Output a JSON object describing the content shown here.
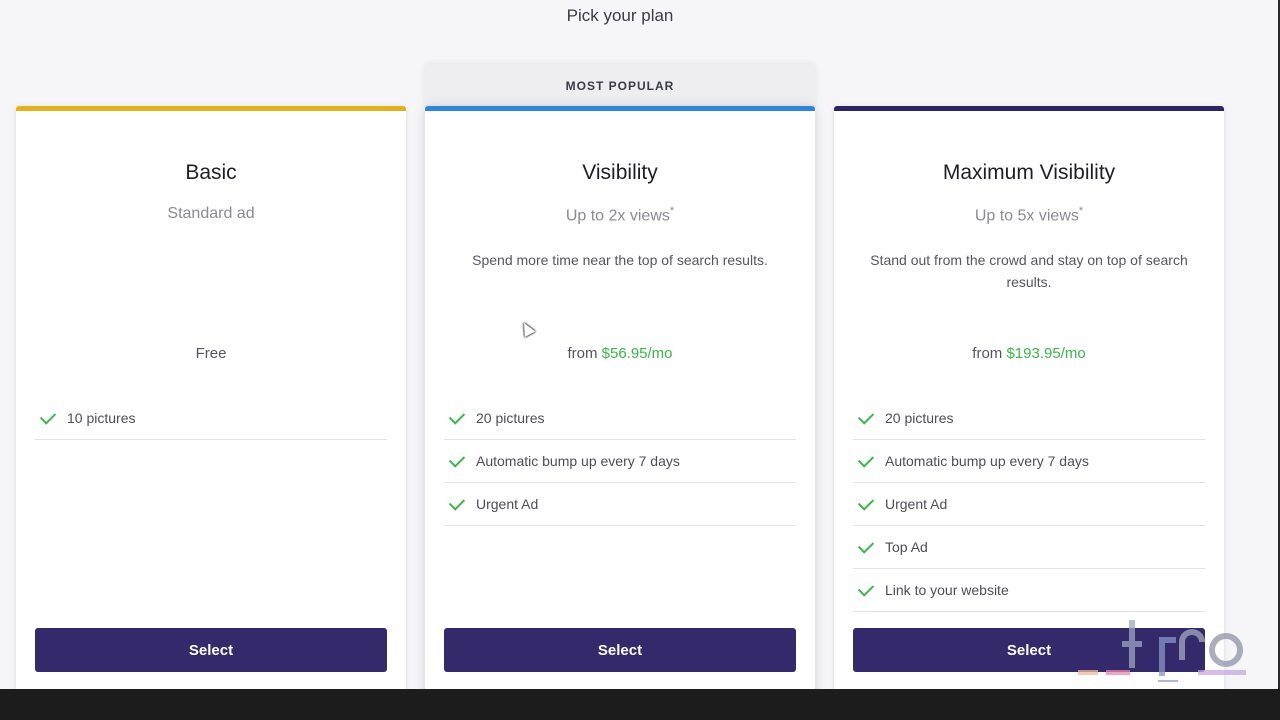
{
  "header": {
    "title": "Pick your plan"
  },
  "badge": {
    "label": "MOST POPULAR"
  },
  "plans": [
    {
      "name": "Basic",
      "subtitle": "Standard ad",
      "description": "",
      "price_text": "Free",
      "features": [
        "10 pictures"
      ],
      "button_label": "Select",
      "accent_color": "#e2b21c"
    },
    {
      "name": "Visibility",
      "subtitle": "Up to 2x views",
      "subtitle_mark": "*",
      "description": "Spend more time near the top of search results.",
      "price_prefix": "from",
      "price_amount": "$56.95/mo",
      "features": [
        "20 pictures",
        "Automatic bump up every 7 days",
        "Urgent Ad"
      ],
      "button_label": "Select",
      "accent_color": "#2f86d6"
    },
    {
      "name": "Maximum Visibility",
      "subtitle": "Up to 5x views",
      "subtitle_mark": "*",
      "description": "Stand out from the crowd and stay on top of search results.",
      "price_prefix": "from",
      "price_amount": "$193.95/mo",
      "features": [
        "20 pictures",
        "Automatic bump up every 7 days",
        "Urgent Ad",
        "Top Ad",
        "Link to your website"
      ],
      "button_label": "Select",
      "accent_color": "#2b2566"
    }
  ],
  "colors": {
    "button": "#33296b",
    "check": "#3bb54a",
    "price_amount": "#3bb54a"
  }
}
